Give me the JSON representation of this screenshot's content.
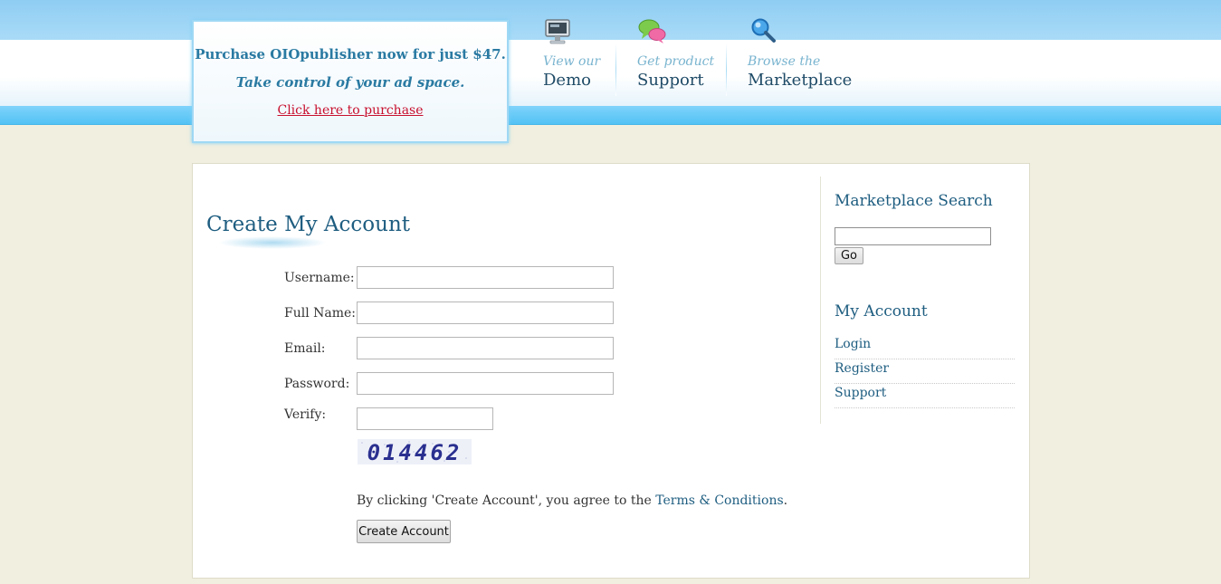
{
  "promo": {
    "headline": "Purchase OIOpublisher now for just $47.",
    "tagline": "Take control of your ad space.",
    "link": "Click here to purchase"
  },
  "nav": {
    "items": [
      {
        "small": "View our",
        "big": "Demo",
        "icon": "monitor-icon"
      },
      {
        "small": "Get product",
        "big": "Support",
        "icon": "chat-bubbles-icon"
      },
      {
        "small": "Browse the",
        "big": "Marketplace",
        "icon": "magnifier-icon"
      }
    ]
  },
  "main": {
    "title": "Create My Account",
    "fields": {
      "username": {
        "label": "Username:",
        "value": ""
      },
      "fullname": {
        "label": "Full Name:",
        "value": ""
      },
      "email": {
        "label": "Email:",
        "value": ""
      },
      "password": {
        "label": "Password:",
        "value": ""
      },
      "verify": {
        "label": "Verify:",
        "value": ""
      }
    },
    "captcha": "014462",
    "agree_prefix": "By clicking 'Create Account', you agree to the ",
    "terms_link": "Terms & Conditions",
    "agree_suffix": ".",
    "submit_label": "Create Account"
  },
  "sidebar": {
    "search_heading": "Marketplace Search",
    "search_value": "",
    "go_label": "Go",
    "account_heading": "My Account",
    "links": [
      "Login",
      "Register",
      "Support"
    ]
  },
  "colors": {
    "accent_text": "#1e5d80",
    "promo_link": "#c8102e",
    "header_bar": "#52c2f4",
    "page_bg": "#f1efdf"
  }
}
